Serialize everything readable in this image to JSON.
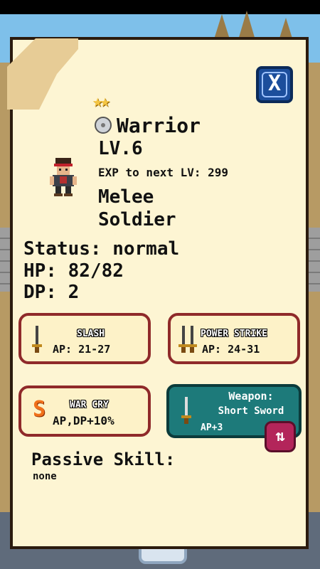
{
  "close_button": {
    "label": "X"
  },
  "hero": {
    "stars": "★★",
    "class_name": "Warrior",
    "level": "LV.6",
    "exp_text": "EXP to next LV: 299",
    "role_line1": "Melee",
    "role_line2": "Soldier",
    "status": "Status: normal",
    "hp": "HP: 82/82",
    "dp": "DP: 2"
  },
  "skills": [
    {
      "name": "SLASH",
      "ap": "AP: 21-27"
    },
    {
      "name": "POWER STRIKE",
      "ap": "AP: 24-31"
    },
    {
      "name": "WAR CRY",
      "ap": "AP,DP+10%",
      "icon": "S"
    }
  ],
  "weapon": {
    "label": "Weapon:",
    "name": "Short Sword",
    "bonus": "AP+3",
    "swap_icon": "⇅"
  },
  "passive": {
    "label": "Passive Skill:",
    "value": "none"
  },
  "colors": {
    "card": "#fdf5d3",
    "skill_border": "#8f2a2a",
    "weapon_bg": "#1d7a7a",
    "close_bg": "#1c4e9c",
    "swap_bg": "#b3255a"
  }
}
